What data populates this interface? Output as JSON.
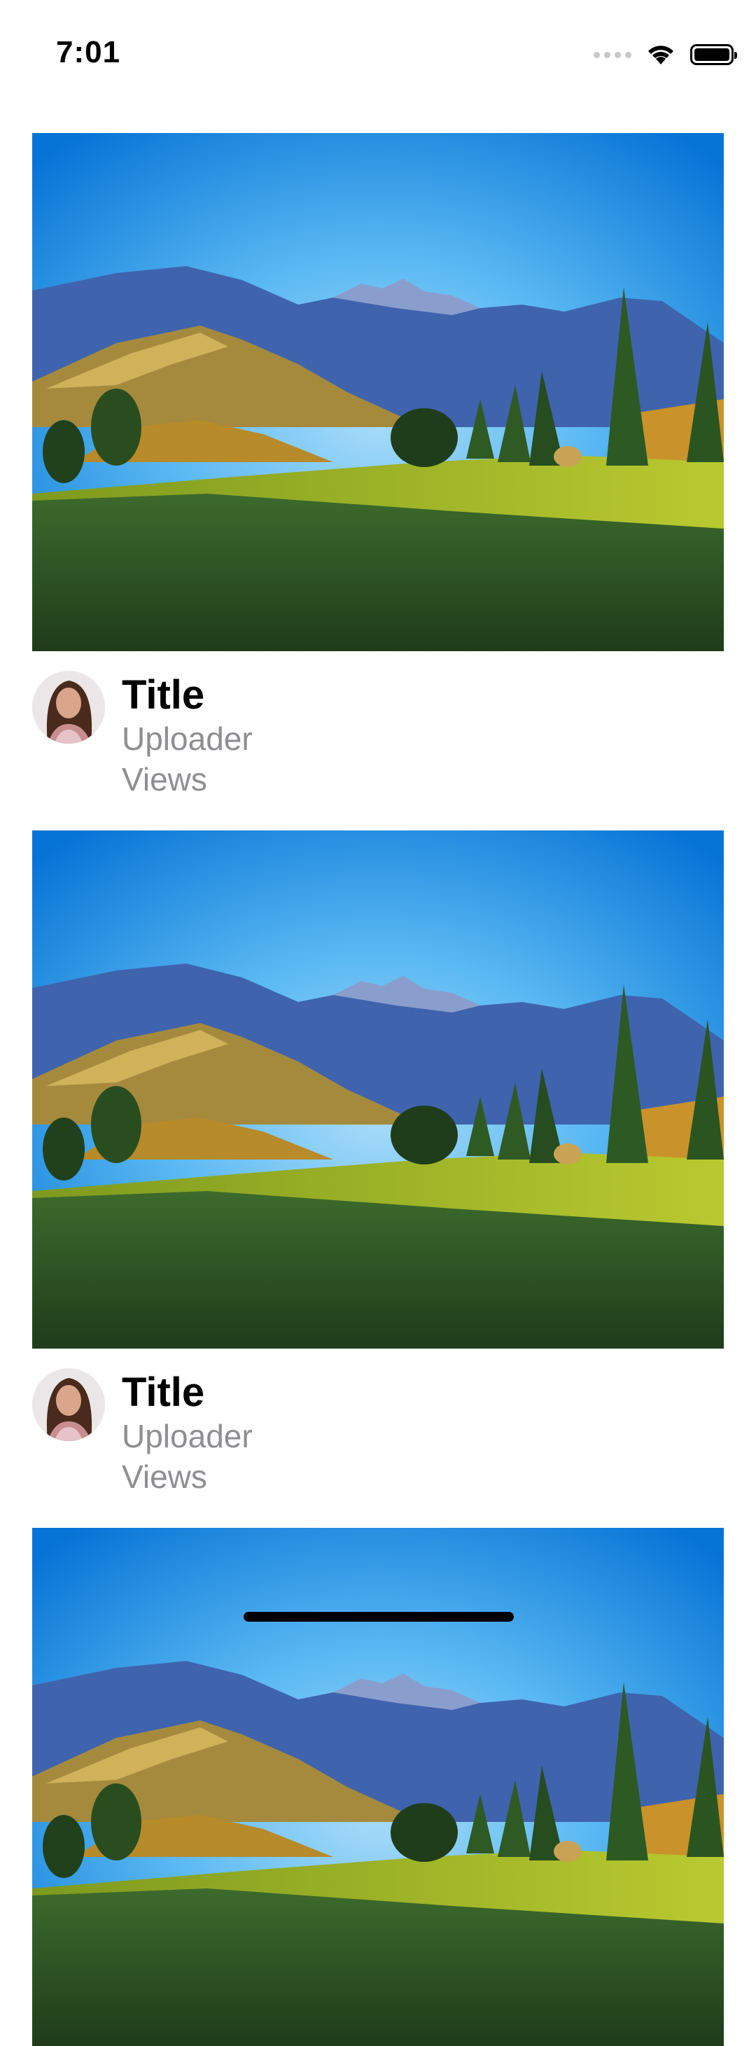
{
  "status_bar": {
    "time": "7:01",
    "icons": [
      "signal-dots-icon",
      "wifi-icon",
      "battery-icon"
    ]
  },
  "feed": {
    "items": [
      {
        "title": "Title",
        "uploader": "Uploader",
        "views": "Views",
        "thumbnail": "mountain-landscape-thumbnail",
        "avatar": "uploader-avatar"
      },
      {
        "title": "Title",
        "uploader": "Uploader",
        "views": "Views",
        "thumbnail": "mountain-landscape-thumbnail",
        "avatar": "uploader-avatar"
      },
      {
        "thumbnail": "mountain-landscape-thumbnail"
      }
    ]
  },
  "colors": {
    "sky_top": "#0a7fe0",
    "sky_glow": "#6ec4f7",
    "mountains": "#3d5fa8",
    "grass": "#2c5624",
    "meadow_sunlit": "#9dbb2a",
    "secondary_text": "#8e8e93"
  }
}
